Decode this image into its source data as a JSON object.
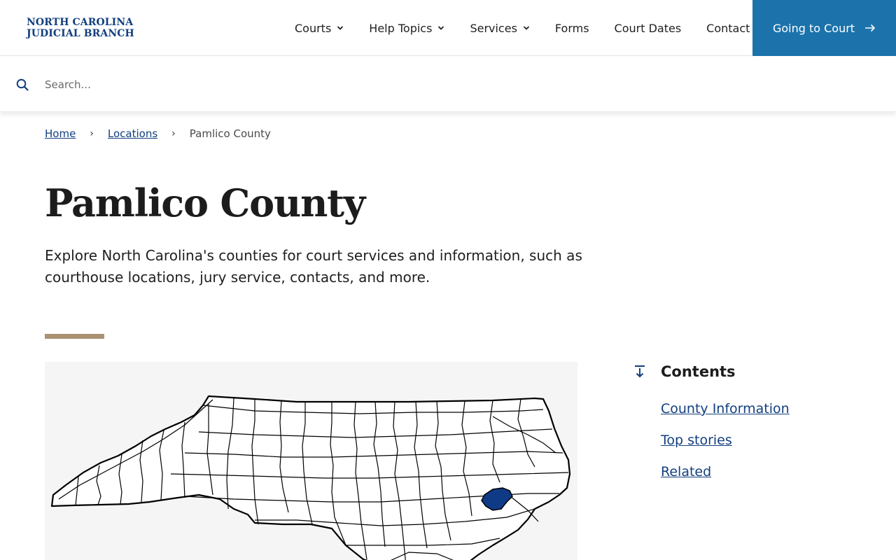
{
  "header": {
    "logo_line1": "NORTH CAROLINA",
    "logo_line2": "JUDICIAL BRANCH",
    "nav": [
      {
        "label": "Courts",
        "has_dropdown": true
      },
      {
        "label": "Help Topics",
        "has_dropdown": true
      },
      {
        "label": "Services",
        "has_dropdown": true
      },
      {
        "label": "Forms",
        "has_dropdown": false
      },
      {
        "label": "Court Dates",
        "has_dropdown": false
      },
      {
        "label": "Contact",
        "has_dropdown": false
      }
    ],
    "cta_label": "Going to Court"
  },
  "search": {
    "placeholder": "Search..."
  },
  "breadcrumb": {
    "home": "Home",
    "locations": "Locations",
    "current": "Pamlico County"
  },
  "main": {
    "title": "Pamlico County",
    "intro": "Explore North Carolina's counties for court services and information, such as courthouse locations, jury service, contacts, and more."
  },
  "contents": {
    "title": "Contents",
    "items": [
      "County Information",
      "Top stories",
      "Related"
    ]
  },
  "colors": {
    "brand_blue": "#123f7f",
    "cta_blue": "#1c73ab",
    "accent_gold": "#a99272",
    "highlight_county": "#0f3a86"
  },
  "icons": {
    "search": "search-icon",
    "chevron": "chevron-down-icon",
    "arrow": "arrow-right-icon",
    "contents": "arrow-down-to-line-icon"
  }
}
